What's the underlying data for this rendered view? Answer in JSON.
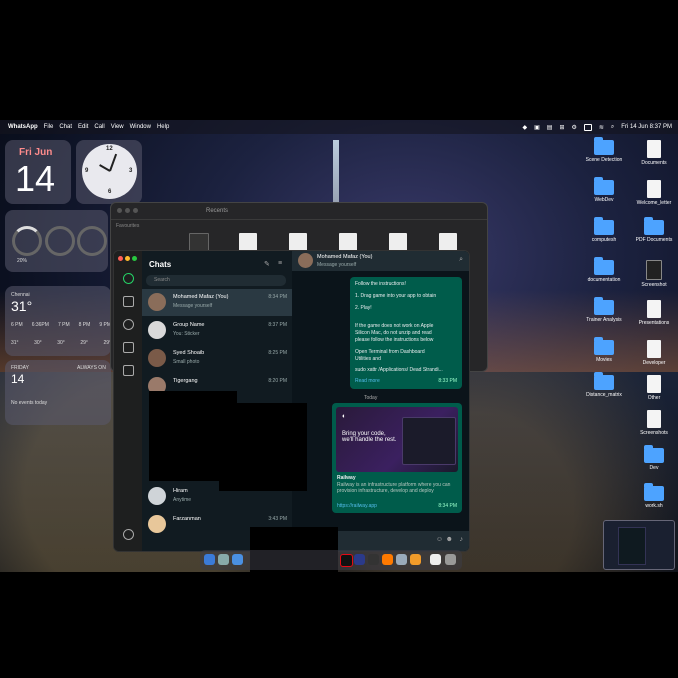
{
  "menubar": {
    "app": "WhatsApp",
    "items": [
      "File",
      "Chat",
      "Edit",
      "Call",
      "View",
      "Window",
      "Help"
    ],
    "clock": "Fri 14 Jun 8:37 PM"
  },
  "widgets": {
    "calendar": {
      "day": "Fri Jun",
      "date": "14"
    },
    "battery": {
      "percent": "20%"
    },
    "weather": {
      "city": "Chennai",
      "temp": "31°",
      "hours": [
        "6 PM",
        "6:36PM",
        "7 PM",
        "8 PM",
        "9 PM"
      ],
      "temps": [
        "31°",
        "30°",
        "30°",
        "29°",
        "29°"
      ]
    },
    "reminders": {
      "day": "FRIDAY",
      "date": "14",
      "note": "No events today",
      "list_label": "ALWAYS ON"
    }
  },
  "desktop": {
    "icons": [
      {
        "label": "Scene Detection",
        "type": "folder"
      },
      {
        "label": "Documents",
        "type": "doc"
      },
      {
        "label": "WebDev",
        "type": "folder"
      },
      {
        "label": "Welcome_letter",
        "type": "doc"
      },
      {
        "label": "computesh",
        "type": "folder"
      },
      {
        "label": "PDF Documents",
        "type": "folder"
      },
      {
        "label": "documentation",
        "type": "folder"
      },
      {
        "label": "Screenshot",
        "type": "doc"
      },
      {
        "label": "Trainer Analysis",
        "type": "folder"
      },
      {
        "label": "Presentations",
        "type": "doc"
      },
      {
        "label": "Movies",
        "type": "folder"
      },
      {
        "label": "Developer",
        "type": "doc"
      },
      {
        "label": "Distance_matrix",
        "type": "folder"
      },
      {
        "label": "Other",
        "type": "doc"
      },
      {
        "label": "Screenshots",
        "type": "doc"
      },
      {
        "label": "Dev",
        "type": "folder"
      },
      {
        "label": "work.sh",
        "type": "folder"
      }
    ]
  },
  "finder": {
    "title": "Recents",
    "sidebar_label": "Favourites"
  },
  "whatsapp": {
    "title": "Chats",
    "search_placeholder": "Search",
    "chats": [
      {
        "name": "Mohamed Mafaz (You)",
        "preview": "Message yourself",
        "time": "8:34 PM"
      },
      {
        "name": "Group Name",
        "preview": "You: Sticker",
        "time": "8:37 PM"
      },
      {
        "name": "Syed Shoaib",
        "preview": "Small photo",
        "time": "8:25 PM"
      },
      {
        "name": "Tigergang",
        "preview": "",
        "time": "8:20 PM"
      },
      {
        "name": "Hiram",
        "preview": "Anytime",
        "time": ""
      },
      {
        "name": "Farzanman",
        "preview": "",
        "time": "3:43 PM"
      }
    ],
    "conversation": {
      "name": "Mohamed Mafaz (You)",
      "subtitle": "Message yourself",
      "msg1_lines": [
        "Follow the instructions!",
        "1. Drag game into your app to obtain",
        "2. Play!",
        "If the game does not work on Apple",
        "Silicon Mac, do not unzip and read",
        "please follow the instructions below",
        "Open Terminal from Dashboard",
        "Utilities and",
        "sudo xattr /Applications/ Dead Strandi..."
      ],
      "read_more": "Read more",
      "msg1_time": "8:33 PM",
      "date_divider": "Today",
      "card_headline": "Bring your code, we'll handle the rest.",
      "card_site": "Railway",
      "card_desc": "Railway is an infrastructure platform where you can provision infrastructure, develop and deploy",
      "card_link": "https://railway.app",
      "msg2_time": "8:34 PM"
    }
  },
  "colors": {
    "wa_bg": "#111b21",
    "wa_bubble": "#005c4b",
    "folder": "#4da3ff"
  }
}
